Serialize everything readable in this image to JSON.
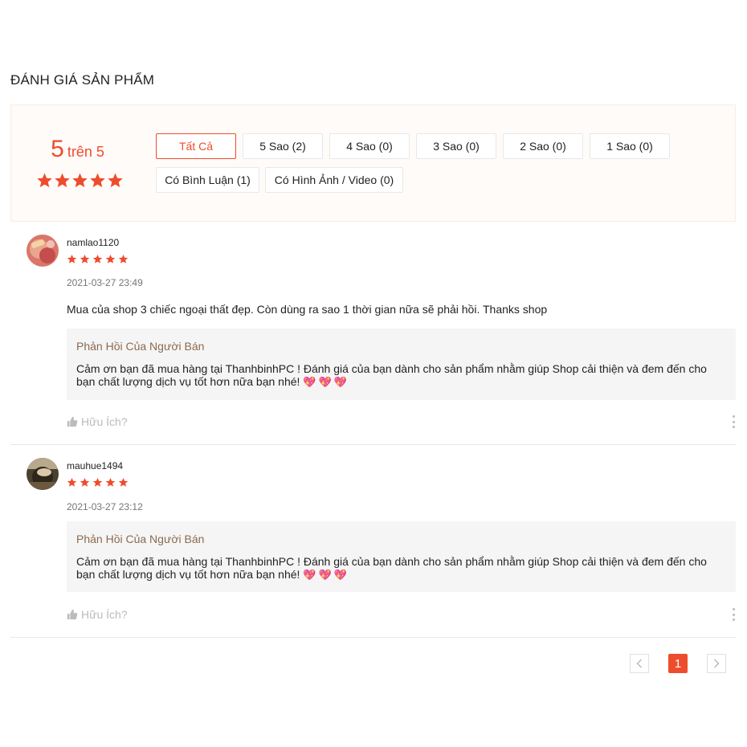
{
  "section_title": "ĐÁNH GIÁ SẢN PHẨM",
  "colors": {
    "accent": "#ee4d2d",
    "reply_title": "#8b6a4f",
    "muted": "#757575"
  },
  "overview": {
    "score": "5",
    "out_of": "trên 5",
    "stars": 5,
    "filters": [
      {
        "label": "Tất Cả",
        "active": true
      },
      {
        "label": "5 Sao (2)",
        "active": false
      },
      {
        "label": "4 Sao (0)",
        "active": false
      },
      {
        "label": "3 Sao (0)",
        "active": false
      },
      {
        "label": "2 Sao (0)",
        "active": false
      },
      {
        "label": "1 Sao (0)",
        "active": false
      },
      {
        "label": "Có Bình Luận (1)",
        "active": false
      },
      {
        "label": "Có Hình Ảnh / Video (0)",
        "active": false
      }
    ]
  },
  "reviews": [
    {
      "username": "namlao1120",
      "rating": 5,
      "time": "2021-03-27 23:49",
      "comment": "Mua của shop 3 chiếc ngoại thất đẹp. Còn dùng ra sao 1 thời gian nữa sẽ phải hồi. Thanks shop",
      "reply_title": "Phản Hồi Của Người Bán",
      "reply_text": "Cảm ơn bạn đã mua hàng tại ThanhbinhPC ! Đánh giá của bạn dành cho sản phẩm nhằm giúp Shop cải thiện và đem đến cho bạn chất lượng dịch vụ tốt hơn nữa bạn nhé!",
      "reply_emoji": "💖💖💖",
      "helpful_label": "Hữu Ích?"
    },
    {
      "username": "mauhue1494",
      "rating": 5,
      "time": "2021-03-27 23:12",
      "comment": "",
      "reply_title": "Phản Hồi Của Người Bán",
      "reply_text": "Cảm ơn bạn đã mua hàng tại ThanhbinhPC ! Đánh giá của bạn dành cho sản phẩm nhằm giúp Shop cải thiện và đem đến cho bạn chất lượng dịch vụ tốt hơn nữa bạn nhé!",
      "reply_emoji": "💖💖💖",
      "helpful_label": "Hữu Ích?"
    }
  ],
  "pagination": {
    "prev_icon": "chevron-left-icon",
    "current": "1",
    "next_icon": "chevron-right-icon"
  }
}
